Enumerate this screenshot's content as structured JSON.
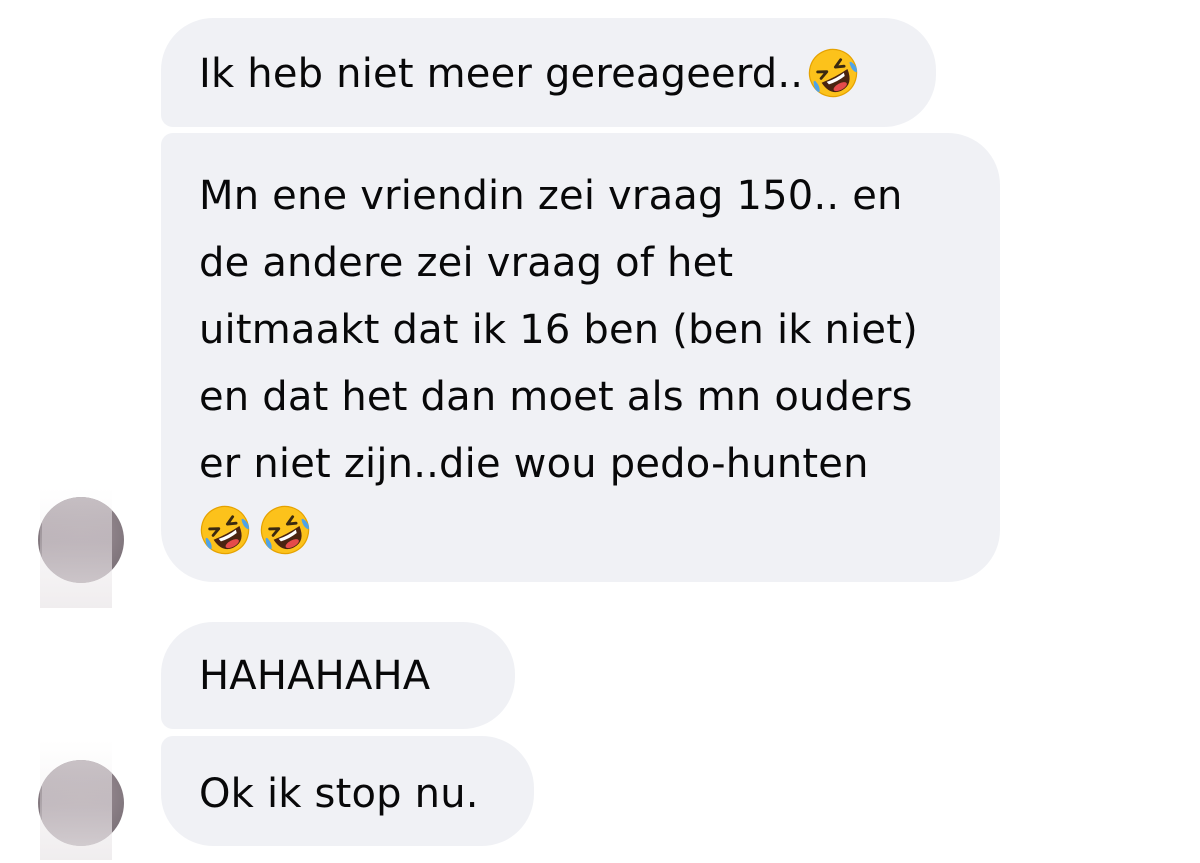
{
  "messages": [
    {
      "lines": [
        "Ik heb niet meer gereageerd.."
      ],
      "emoji": "rofl-emoji"
    },
    {
      "lines": [
        "Mn ene vriendin zei vraag 150.. en",
        "de andere zei vraag of het",
        "uitmaakt dat ik 16 ben (ben ik niet)",
        "en dat het dan moet als mn ouders",
        "er niet zijn..die wou pedo-hunten"
      ],
      "emoji_line": [
        "rofl-emoji",
        "rofl-emoji"
      ]
    },
    {
      "lines": [
        "HAHAHAHA"
      ]
    },
    {
      "lines": [
        "Ok ik stop nu."
      ]
    }
  ],
  "colors": {
    "bubble": "#f0f1f5",
    "text": "#080809",
    "emoji_face": "#fcc21b",
    "emoji_tears": "#4fa3e8"
  },
  "icons": [
    "rofl-emoji",
    "avatar"
  ]
}
